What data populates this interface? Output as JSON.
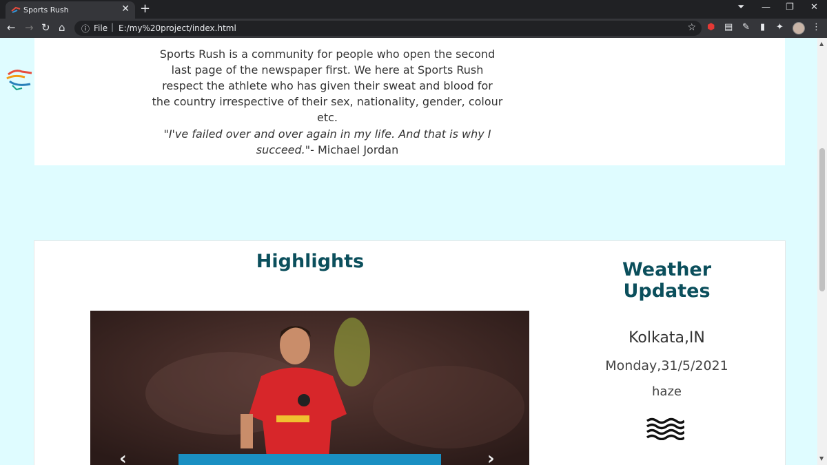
{
  "browser": {
    "tab_title": "Sports Rush",
    "tab_close": "✕",
    "new_tab": "+",
    "omnibox_scheme": "File",
    "omnibox_separator": "|",
    "url": "E:/my%20project/index.html"
  },
  "about": {
    "paragraph": "Sports Rush is a community for people who open the second last page of the newspaper first. We here at Sports Rush respect the athlete who has given their sweat and blood for the country irrespective of their sex, nationality, gender, colour etc.",
    "quote_text": "\"I've failed over and over again in my life. And that is why I succeed.\"",
    "quote_author": "- Michael Jordan"
  },
  "highlights": {
    "title": "Highlights",
    "prev_label": "‹",
    "next_label": "›"
  },
  "weather": {
    "title": "Weather Updates",
    "city": "Kolkata,IN",
    "date": "Monday,31/5/2021",
    "condition": "haze",
    "icon": "haze-icon"
  },
  "colors": {
    "page_bg": "#dffcff",
    "heading": "#0b4f5c",
    "caption_bar": "#1a8fc2"
  }
}
